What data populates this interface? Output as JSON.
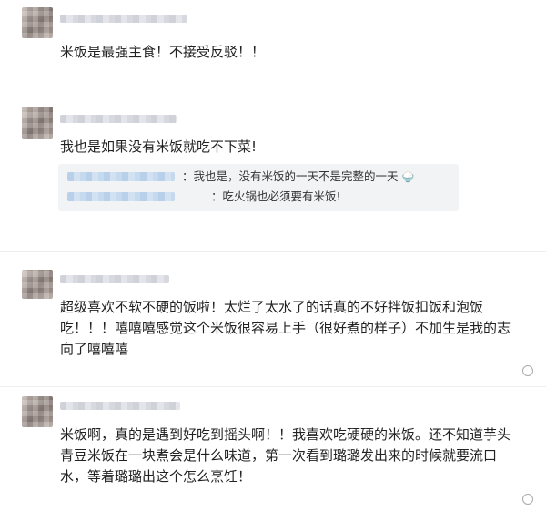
{
  "comments": [
    {
      "text": "米饭是最强主食！不接受反驳！！"
    },
    {
      "text": "我也是如果没有米饭就吃不下菜!",
      "replies": [
        {
          "text": "：我也是，没有米饭的一天不是完整的一天"
        },
        {
          "text": "：吃火锅也必须要有米饭!"
        }
      ]
    },
    {
      "text_lines": [
        "超级喜欢不软不硬的饭啦！太烂了太水了的话真的不好拌饭扣饭和泡饭",
        "吃！！！嘻嘻嘻感觉这个米饭很容易上手（很好煮的样子）不加生是我的志",
        "向了嘻嘻嘻"
      ]
    },
    {
      "text_lines": [
        "米饭啊，真的是遇到好吃到摇头啊！！我喜欢吃硬硬的米饭。还不知道芋头",
        "青豆米饭在一块煮会是什么味道，第一次看到璐璐发出来的时候就要流口",
        "水，等着璐璐出这个怎么烹饪！"
      ]
    }
  ],
  "icons": {
    "reply": "comment-icon",
    "emoji": "rice-bowl-emoji"
  }
}
